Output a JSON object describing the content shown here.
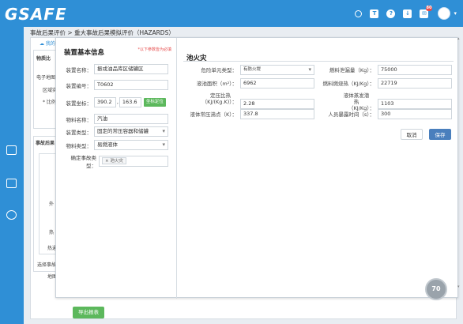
{
  "header": {
    "logo": "GSAFE",
    "icons": [
      "search-icon",
      "shirt-icon",
      "help-icon",
      "download-icon",
      "mail-icon",
      "avatar"
    ],
    "mail_badge": "80"
  },
  "sidebar": {
    "icons": [
      "package-icon",
      "grid-icon",
      "pie-chart-icon"
    ]
  },
  "breadcrumb": {
    "text": "事故后果评价 > 重大事故后果模拟评价（HAZARDS）"
  },
  "background_page": {
    "tab_label": "我的",
    "section1_label": "物质比",
    "line1": "电子地图",
    "line2": "区域实",
    "line3": "* 比例",
    "section2_label": "事故后果",
    "side_label1": "外",
    "side_label2": "热",
    "side_label3": "热通",
    "bottom_label": "选择事故",
    "bottom_sub": "地图",
    "export_button": "导出报表"
  },
  "left_form": {
    "title": "装置基本信息",
    "hint": "*以下参数皆为必填",
    "fields": [
      {
        "label": "装置名称：",
        "value": "振戎油品库区储罐区"
      },
      {
        "label": "装置编号：",
        "value": "T0602"
      },
      {
        "label": "装置坐标：",
        "x": "390.2",
        "y": "163.6",
        "button": "坐标定位"
      },
      {
        "label": "物料名称：",
        "value": "汽油"
      },
      {
        "label": "装置类型：",
        "value": "固定的常压容器和储罐"
      },
      {
        "label": "物料类型：",
        "value": "易燃液体"
      },
      {
        "label": "确定事故类型：",
        "tag": "池火灾"
      }
    ]
  },
  "right_form": {
    "title": "池火灾",
    "danger_type_label": "危险单元类型：",
    "danger_type_value": "有防火堤",
    "fuel_mass_label": "燃料泄漏量（Kg）：",
    "fuel_mass_value": "75000",
    "pool_area_label": "液池面积（m²）：",
    "pool_area_value": "6962",
    "combustion_heat_label": "燃料燃烧热（KJ/Kg）：",
    "combustion_heat_value": "22719",
    "specific_heat_label_1": "定压比热",
    "specific_heat_label_2": "（KJ/(Kg.K)）：",
    "specific_heat_value": "2.28",
    "vaporization_label_1": "液体蒸发潜热",
    "vaporization_label_2": "（KJ/Kg）：",
    "vaporization_value": "1103",
    "boiling_point_label": "液体常压沸点（K）：",
    "boiling_point_value": "337.8",
    "exposure_label": "人员暴露时间（s）：",
    "exposure_value": "300",
    "cancel_button": "取消",
    "save_button": "保存"
  },
  "zoom": {
    "label": "70"
  },
  "colors": {
    "brand": "#2f8fd6",
    "save": "#4a7fbd",
    "green": "#5cb85c",
    "hint": "#e64b4b"
  }
}
